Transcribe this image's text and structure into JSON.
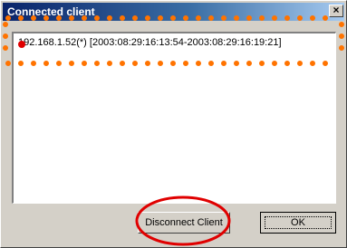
{
  "window": {
    "title": "Connected client",
    "close_glyph": "×"
  },
  "client_list": {
    "items": [
      "192.168.1.52(*) [2003:08:29:16:13:54-2003:08:29:16:19:21]"
    ]
  },
  "buttons": {
    "disconnect_label": "Disconnect Client",
    "ok_label": "OK"
  },
  "annotations": {
    "dotted_color": "#ff7300",
    "circle_color": "#e00000"
  }
}
